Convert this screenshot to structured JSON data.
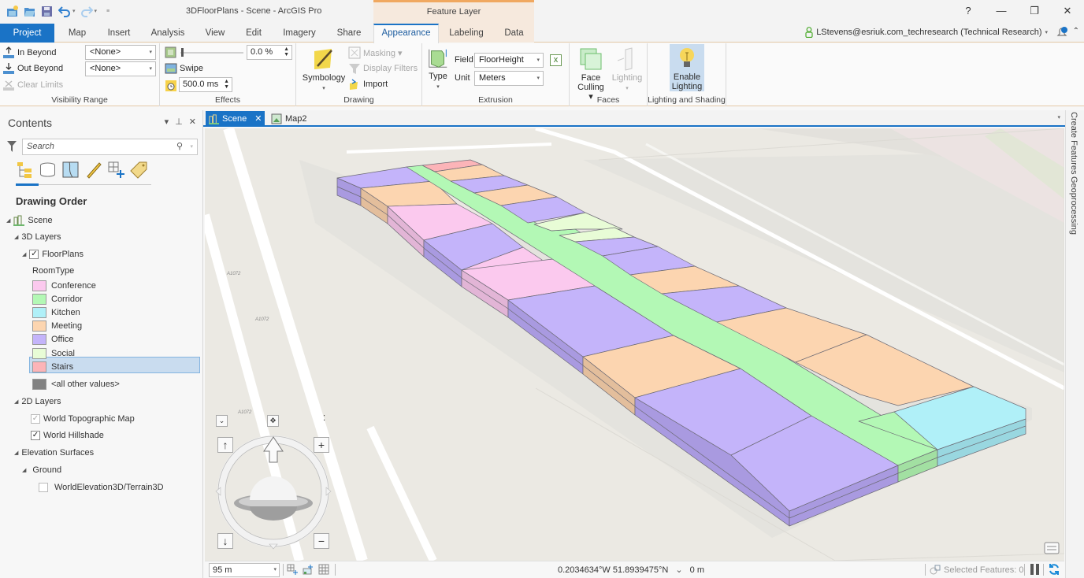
{
  "window": {
    "title": "3DFloorPlans - Scene - ArcGIS Pro",
    "context_header": "Feature Layer",
    "controls": {
      "help": "?",
      "minimize": "—",
      "restore": "❐",
      "close": "✕"
    }
  },
  "quick_access": [
    "new-project-icon",
    "open-project-icon",
    "save-project-icon",
    "undo-icon",
    "redo-icon",
    "customize-icon"
  ],
  "ribbon_tabs": [
    {
      "label": "Project",
      "state": "project"
    },
    {
      "label": "Map"
    },
    {
      "label": "Insert"
    },
    {
      "label": "Analysis"
    },
    {
      "label": "View"
    },
    {
      "label": "Edit"
    },
    {
      "label": "Imagery"
    },
    {
      "label": "Share"
    },
    {
      "label": "Appearance",
      "state": "active"
    },
    {
      "label": "Labeling"
    },
    {
      "label": "Data"
    }
  ],
  "account": {
    "label": "LStevens@esriuk.com_techresearch (Technical Research)",
    "dropdown": "▾",
    "collapse": "⌃"
  },
  "ribbon": {
    "visibility_range": {
      "label": "Visibility Range",
      "in_beyond": "In Beyond",
      "out_beyond": "Out Beyond",
      "clear_limits": "Clear Limits",
      "in_value": "<None>",
      "out_value": "<None>"
    },
    "effects": {
      "label": "Effects",
      "transparency": "0.0 %",
      "transparency_fraction": 0.0,
      "swipe": "Swipe",
      "flicker": "500.0  ms"
    },
    "drawing": {
      "label": "Drawing",
      "symbology": "Symbology",
      "masking": "Masking ▾",
      "display_filters": "Display Filters",
      "import": "Import"
    },
    "extrusion": {
      "label": "Extrusion",
      "type": "Type",
      "field_label": "Field",
      "field_value": "FloorHeight",
      "unit_label": "Unit",
      "unit_value": "Meters"
    },
    "faces": {
      "label": "Faces",
      "face_culling_1": "Face",
      "face_culling_2": "Culling ▾",
      "lighting": "Lighting"
    },
    "lighting_shading": {
      "label": "Lighting and Shading",
      "enable_1": "Enable",
      "enable_2": "Lighting"
    }
  },
  "contents": {
    "title": "Contents",
    "search_placeholder": "Search",
    "drawing_order": "Drawing Order",
    "scene": "Scene",
    "layers_3d": "3D Layers",
    "floorplans": "FloorPlans",
    "field": "RoomType",
    "legend": [
      {
        "label": "Conference",
        "color": "#fbc9ee"
      },
      {
        "label": "Corridor",
        "color": "#b3f8b5"
      },
      {
        "label": "Kitchen",
        "color": "#b0f0f8"
      },
      {
        "label": "Meeting",
        "color": "#fcd5b0"
      },
      {
        "label": "Office",
        "color": "#c4b4fa"
      },
      {
        "label": "Social",
        "color": "#e8fcd6"
      },
      {
        "label": "Stairs",
        "color": "#fcb4b8"
      },
      {
        "label": "<all other values>",
        "color": "#828282"
      }
    ],
    "layers_2d": "2D Layers",
    "topo": "World Topographic Map",
    "hillshade": "World Hillshade",
    "elevation": "Elevation Surfaces",
    "ground": "Ground",
    "terrain": "WorldElevation3D/Terrain3D"
  },
  "map_tabs": [
    {
      "label": "Scene",
      "close": "✕",
      "active": true
    },
    {
      "label": "Map2"
    }
  ],
  "dock": {
    "create_features": "Create Features",
    "geoprocessing": "Geoprocessing"
  },
  "map_labels": [
    "A1072",
    "A1072",
    "A1072"
  ],
  "status": {
    "scale": "95 m",
    "coords": "0.2034634°W 51.8939475°N",
    "elev_dd": "⌄",
    "elevation": "0 m",
    "selected": "Selected Features: 0"
  },
  "colors": {
    "accent": "#1a73c6",
    "context_tab": "#f6e9dd",
    "context_accent": "#f0a860"
  }
}
